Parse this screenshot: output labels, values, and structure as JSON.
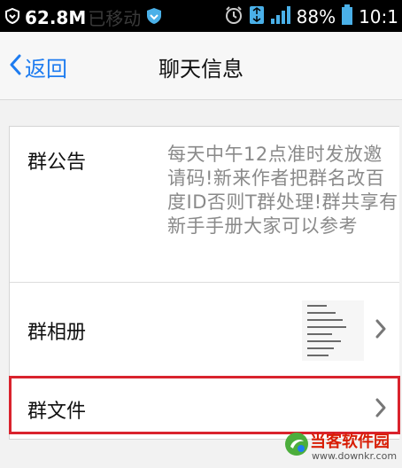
{
  "status_bar": {
    "memory": "62.8M",
    "faded_text": "已移动",
    "battery": "88%",
    "time": "10:1"
  },
  "nav": {
    "back_label": "返回",
    "title": "聊天信息"
  },
  "notice": {
    "label": "群公告",
    "text": "每天中午12点准时发放邀请码!新来作者把群名改百度ID否则T群处理!群共享有新手手册大家可以参考"
  },
  "album": {
    "label": "群相册"
  },
  "files": {
    "label": "群文件"
  },
  "watermark": {
    "name": "当客软件园",
    "url": "www.downkr.com"
  },
  "colors": {
    "accent": "#1e7cf0",
    "highlight": "#d9232d",
    "background": "#f2f2f2"
  }
}
